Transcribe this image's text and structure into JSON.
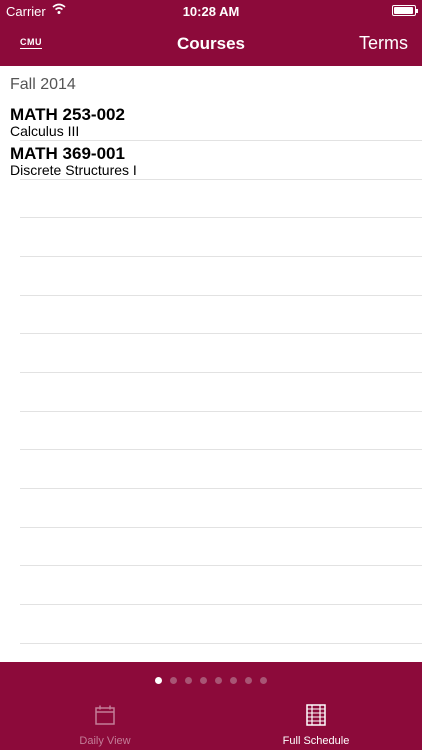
{
  "status_bar": {
    "carrier": "Carrier",
    "time": "10:28 AM",
    "battery_level": 0.95
  },
  "nav": {
    "logo": "CMU",
    "title": "Courses",
    "right_button": "Terms"
  },
  "section": {
    "term": "Fall 2014"
  },
  "courses": [
    {
      "code": "MATH 253-002",
      "name": "Calculus III"
    },
    {
      "code": "MATH 369-001",
      "name": "Discrete Structures I"
    }
  ],
  "pager": {
    "count": 8,
    "active_index": 0
  },
  "tabs": [
    {
      "label": "Daily View",
      "icon": "calendar-icon",
      "selected": false
    },
    {
      "label": "Full Schedule",
      "icon": "schedule-list-icon",
      "selected": true
    }
  ],
  "colors": {
    "brand": "#8c0a3a",
    "tab_inactive": "#c37d98",
    "divider": "#e2e2e2"
  }
}
